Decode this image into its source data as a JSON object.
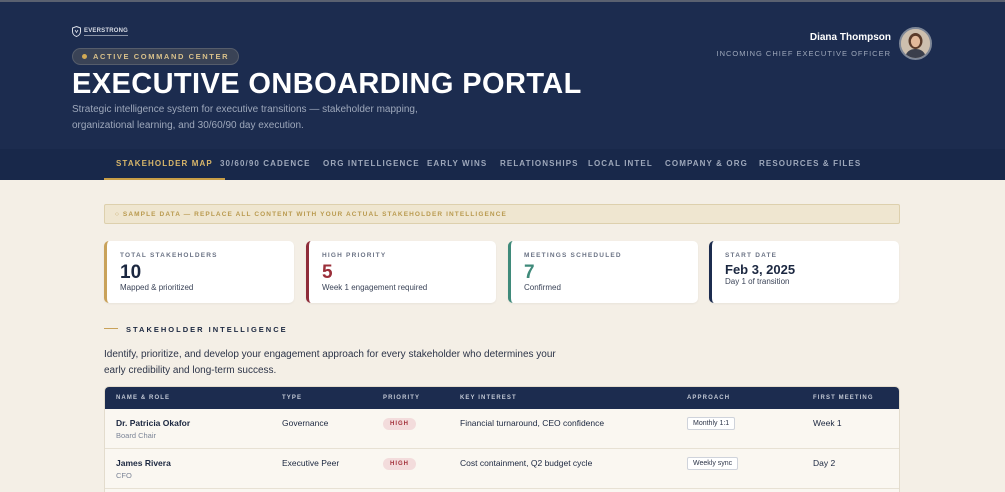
{
  "header": {
    "logo_text": "EVERSTRONG",
    "badge": "ACTIVE COMMAND CENTER",
    "title": "EXECUTIVE ONBOARDING PORTAL",
    "subtitle": "Strategic intelligence system for executive transitions — stakeholder mapping, organizational learning, and 30/60/90 day execution.",
    "user": {
      "name": "Diana Thompson",
      "role": "INCOMING CHIEF EXECUTIVE OFFICER"
    }
  },
  "nav": {
    "tabs": [
      {
        "label": "STAKEHOLDER MAP",
        "active": true
      },
      {
        "label": "30/60/90 CADENCE"
      },
      {
        "label": "ORG INTELLIGENCE"
      },
      {
        "label": "EARLY WINS"
      },
      {
        "label": "RELATIONSHIPS"
      },
      {
        "label": "LOCAL INTEL"
      },
      {
        "label": "COMPANY & ORG"
      },
      {
        "label": "RESOURCES & FILES"
      }
    ]
  },
  "banner": "○ SAMPLE DATA — REPLACE ALL CONTENT WITH YOUR ACTUAL STAKEHOLDER INTELLIGENCE",
  "stats": [
    {
      "label": "TOTAL STAKEHOLDERS",
      "value": "10",
      "sub": "Mapped & prioritized",
      "accent": "#c9a25a",
      "value_color": "#1b2740"
    },
    {
      "label": "HIGH PRIORITY",
      "value": "5",
      "sub": "Week 1 engagement required",
      "accent": "#8e2c39",
      "value_color": "#9b2f3a"
    },
    {
      "label": "MEETINGS SCHEDULED",
      "value": "7",
      "sub": "Confirmed",
      "accent": "#3f8a7a",
      "value_color": "#3f8a7a"
    },
    {
      "label": "START DATE",
      "value": "Feb 3, 2025",
      "sub": "Day 1 of transition",
      "accent": "#1c2c4f",
      "value_color": "#1b2740"
    }
  ],
  "section": {
    "title": "STAKEHOLDER INTELLIGENCE",
    "description": "Identify, prioritize, and develop your engagement approach for every stakeholder who determines your early credibility and long-term success."
  },
  "table": {
    "columns": [
      "NAME & ROLE",
      "TYPE",
      "PRIORITY",
      "KEY INTEREST",
      "APPROACH",
      "FIRST MEETING"
    ],
    "rows": [
      {
        "name": "Dr. Patricia Okafor",
        "role": "Board Chair",
        "type": "Governance",
        "priority": "HIGH",
        "interest": "Financial turnaround, CEO confidence",
        "approach": "Monthly 1:1",
        "first_meeting": "Week 1"
      },
      {
        "name": "James Rivera",
        "role": "CFO",
        "type": "Executive Peer",
        "priority": "HIGH",
        "interest": "Cost containment, Q2 budget cycle",
        "approach": "Weekly sync",
        "first_meeting": "Day 2"
      }
    ]
  },
  "colors": {
    "navy": "#1c2c4f",
    "gold": "#c9a25a",
    "cream": "#f4efe6"
  },
  "icons": {
    "logo": "shield-icon",
    "status": "status-dot-icon"
  }
}
